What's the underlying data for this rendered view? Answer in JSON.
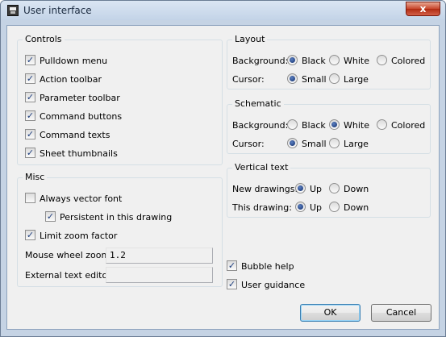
{
  "window": {
    "title": "User interface",
    "close_glyph": "x"
  },
  "controls": {
    "title": "Controls",
    "items": [
      {
        "label": "Pulldown menu",
        "checked": true
      },
      {
        "label": "Action toolbar",
        "checked": true
      },
      {
        "label": "Parameter toolbar",
        "checked": true
      },
      {
        "label": "Command buttons",
        "checked": true
      },
      {
        "label": "Command texts",
        "checked": true
      },
      {
        "label": "Sheet thumbnails",
        "checked": true
      }
    ]
  },
  "misc": {
    "title": "Misc",
    "always_vector_font": {
      "label": "Always vector font",
      "checked": false
    },
    "persistent": {
      "label": "Persistent in this drawing",
      "checked": true
    },
    "limit_zoom": {
      "label": "Limit zoom factor",
      "checked": true
    },
    "mouse_wheel_zoom": {
      "label": "Mouse wheel zoom",
      "value": "1.2"
    },
    "external_text_editor": {
      "label": "External text editor",
      "value": ""
    }
  },
  "layout": {
    "title": "Layout",
    "background": {
      "label": "Background:",
      "options": [
        "Black",
        "White",
        "Colored"
      ],
      "selected": "Black"
    },
    "cursor": {
      "label": "Cursor:",
      "options": [
        "Small",
        "Large"
      ],
      "selected": "Small"
    }
  },
  "schematic": {
    "title": "Schematic",
    "background": {
      "label": "Background:",
      "options": [
        "Black",
        "White",
        "Colored"
      ],
      "selected": "White"
    },
    "cursor": {
      "label": "Cursor:",
      "options": [
        "Small",
        "Large"
      ],
      "selected": "Small"
    }
  },
  "vertical_text": {
    "title": "Vertical text",
    "new_drawings": {
      "label": "New drawings:",
      "options": [
        "Up",
        "Down"
      ],
      "selected": "Up"
    },
    "this_drawing": {
      "label": "This drawing:",
      "options": [
        "Up",
        "Down"
      ],
      "selected": "Up"
    }
  },
  "help": {
    "bubble_help": {
      "label": "Bubble help",
      "checked": true
    },
    "user_guidance": {
      "label": "User guidance",
      "checked": true
    }
  },
  "buttons": {
    "ok": "OK",
    "cancel": "Cancel"
  },
  "check_glyph": "✓"
}
